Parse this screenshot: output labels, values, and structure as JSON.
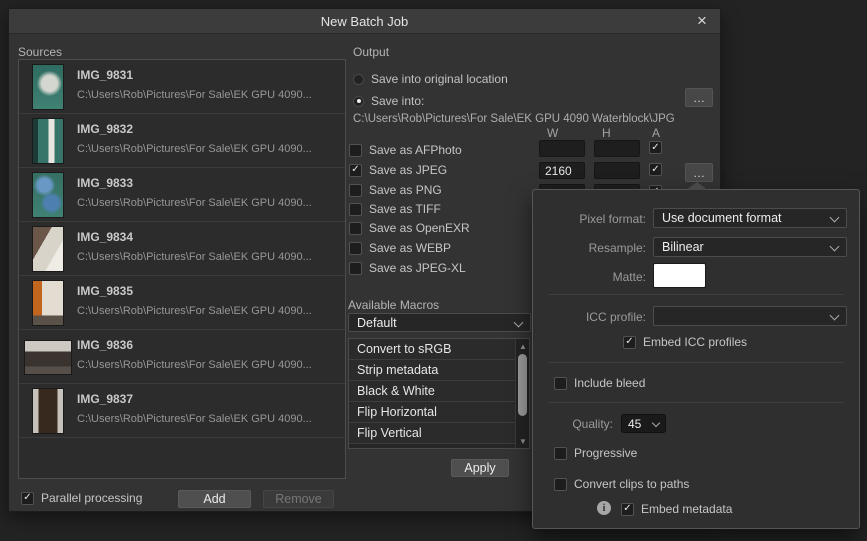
{
  "icons": {
    "close": "×",
    "check": "✓",
    "dots": "…",
    "up": "▲",
    "down": "▼",
    "info": "i"
  },
  "dialog": {
    "title": "New Batch Job"
  },
  "sources": {
    "label": "Sources",
    "items": [
      {
        "name": "IMG_9831",
        "path": "C:\\Users\\Rob\\Pictures\\For Sale\\EK GPU 4090..."
      },
      {
        "name": "IMG_9832",
        "path": "C:\\Users\\Rob\\Pictures\\For Sale\\EK GPU 4090..."
      },
      {
        "name": "IMG_9833",
        "path": "C:\\Users\\Rob\\Pictures\\For Sale\\EK GPU 4090..."
      },
      {
        "name": "IMG_9834",
        "path": "C:\\Users\\Rob\\Pictures\\For Sale\\EK GPU 4090..."
      },
      {
        "name": "IMG_9835",
        "path": "C:\\Users\\Rob\\Pictures\\For Sale\\EK GPU 4090..."
      },
      {
        "name": "IMG_9836",
        "path": "C:\\Users\\Rob\\Pictures\\For Sale\\EK GPU 4090..."
      },
      {
        "name": "IMG_9837",
        "path": "C:\\Users\\Rob\\Pictures\\For Sale\\EK GPU 4090..."
      }
    ],
    "parallel_label": "Parallel processing",
    "parallel_checked": true,
    "add_label": "Add",
    "remove_label": "Remove",
    "remove_enabled": false
  },
  "output": {
    "label": "Output",
    "save_original_label": "Save into original location",
    "save_into_label": "Save into:",
    "selected_option": "save_into",
    "path": "C:\\Users\\Rob\\Pictures\\For Sale\\EK GPU 4090 Waterblock\\JPG",
    "col_w": "W",
    "col_h": "H",
    "col_a": "A",
    "formats": [
      {
        "label": "Save as AFPhoto",
        "checked": false,
        "w": "",
        "h": "",
        "auto": true
      },
      {
        "label": "Save as JPEG",
        "checked": true,
        "w": "2160",
        "h": "",
        "auto": true
      },
      {
        "label": "Save as PNG",
        "checked": false,
        "w": "",
        "h": "",
        "auto": true
      },
      {
        "label": "Save as TIFF",
        "checked": false
      },
      {
        "label": "Save as OpenEXR",
        "checked": false
      },
      {
        "label": "Save as WEBP",
        "checked": false
      },
      {
        "label": "Save as JPEG-XL",
        "checked": false
      }
    ]
  },
  "macros": {
    "label": "Available Macros",
    "category_value": "Default",
    "items": [
      "Convert to sRGB",
      "Strip metadata",
      "Black & White",
      "Flip Horizontal",
      "Flip Vertical"
    ],
    "apply_label": "Apply"
  },
  "jpeg_options": {
    "pixel_format_label": "Pixel format:",
    "pixel_format_value": "Use document format",
    "resample_label": "Resample:",
    "resample_value": "Bilinear",
    "matte_label": "Matte:",
    "matte_color": "#ffffff",
    "icc_profile_label": "ICC profile:",
    "icc_profile_value": "",
    "embed_icc_label": "Embed ICC profiles",
    "embed_icc_checked": true,
    "include_bleed_label": "Include bleed",
    "include_bleed_checked": false,
    "quality_label": "Quality:",
    "quality_value": "45",
    "progressive_label": "Progressive",
    "progressive_checked": false,
    "convert_clips_label": "Convert clips to paths",
    "convert_clips_checked": false,
    "embed_metadata_label": "Embed metadata",
    "embed_metadata_checked": true
  }
}
